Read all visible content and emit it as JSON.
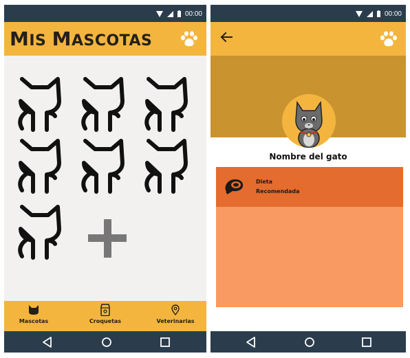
{
  "status_bar": {
    "time": "00:00"
  },
  "left_screen": {
    "title": "Mis mascotas",
    "title_parts": {
      "cap1": "M",
      "rest1": "IS ",
      "cap2": "M",
      "rest2": "ASCOTAS"
    },
    "pets": [
      {
        "name": "",
        "icon": "cat-outline-icon"
      },
      {
        "name": "",
        "icon": "cat-outline-icon"
      },
      {
        "name": "",
        "icon": "cat-outline-icon"
      },
      {
        "name": "",
        "icon": "cat-outline-icon"
      },
      {
        "name": "",
        "icon": "cat-outline-icon"
      },
      {
        "name": "",
        "icon": "cat-outline-icon"
      },
      {
        "name": "",
        "icon": "cat-outline-icon"
      }
    ],
    "add_icon": "plus-icon",
    "bottom_nav": [
      {
        "label": "Mascotas",
        "icon": "cat-head-icon"
      },
      {
        "label": "Croquetas",
        "icon": "food-bag-icon"
      },
      {
        "label": "Veterinarias",
        "icon": "location-pin-icon"
      }
    ]
  },
  "right_screen": {
    "pet_name": "Nombre del gato",
    "diet_card": {
      "line1": "Dieta",
      "line2": "Recomendada",
      "icon": "meat-icon"
    }
  },
  "colors": {
    "primary": "#f4b53e",
    "header_band": "#c99330",
    "system_bar": "#2b3d4d",
    "card_dark": "#e36c2e",
    "card_light": "#f89a61",
    "background": "#f2f1f0"
  }
}
